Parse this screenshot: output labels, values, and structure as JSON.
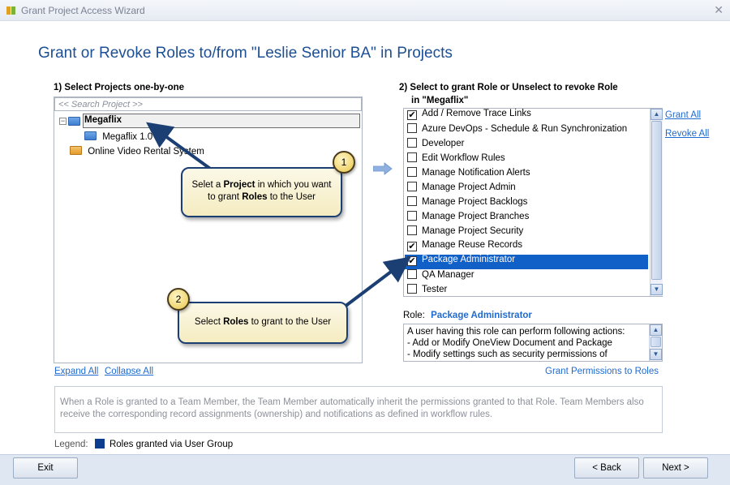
{
  "window": {
    "title": "Grant Project Access Wizard"
  },
  "heading": "Grant or Revoke Roles to/from \"Leslie Senior BA\" in Projects",
  "projects_section": {
    "label": "1) Select Projects one-by-one",
    "search_placeholder": "<< Search Project >>",
    "tree": [
      {
        "label": "Megaflix",
        "expanded": true,
        "selected": true,
        "icon": "folder-icon"
      },
      {
        "label": "Megaflix 1.0",
        "icon": "folder-icon"
      },
      {
        "label": "Online Video Rental System",
        "icon": "folder-icon"
      }
    ],
    "expand_all": "Expand All",
    "collapse_all": "Collapse All"
  },
  "roles_section": {
    "label_line1": "2) Select to grant Role or Unselect to revoke Role",
    "label_line2": "in \"Megaflix\"",
    "grant_all": "Grant All",
    "revoke_all": "Revoke All",
    "roles": [
      {
        "label": "Add / Remove Trace Links",
        "checked": true
      },
      {
        "label": "Azure DevOps - Schedule & Run Synchronization",
        "checked": false
      },
      {
        "label": "Developer",
        "checked": false
      },
      {
        "label": "Edit Workflow Rules",
        "checked": false
      },
      {
        "label": "Manage Notification Alerts",
        "checked": false
      },
      {
        "label": "Manage Project Admin",
        "checked": false
      },
      {
        "label": "Manage Project Backlogs",
        "checked": false
      },
      {
        "label": "Manage Project Branches",
        "checked": false
      },
      {
        "label": "Manage Project Security",
        "checked": false
      },
      {
        "label": "Manage Reuse Records",
        "checked": true
      },
      {
        "label": "Package Administrator",
        "checked": true,
        "selected": true
      },
      {
        "label": "QA Manager",
        "checked": false
      },
      {
        "label": "Tester",
        "checked": false
      }
    ],
    "role_label": "Role:",
    "role_name": "Package Administrator",
    "role_description": [
      "A user having this role can perform following actions:",
      "- Add or Modify OneView Document and Package",
      "- Modify settings such as security permissions of"
    ],
    "grant_permissions_link": "Grant Permissions to Roles"
  },
  "info_text": "When a Role is granted to a Team Member, the Team Member automatically inherit the permissions granted to that Role. Team Members also receive the corresponding record assignments (ownership) and notifications as defined in workflow rules.",
  "legend": {
    "label": "Legend:",
    "item": "Roles granted via User Group",
    "color": "#0c3d8f"
  },
  "buttons": {
    "exit": "Exit",
    "back": "< Back",
    "next": "Next >"
  },
  "callouts": [
    {
      "number": "1",
      "text_before": "Selet a ",
      "bold1": "Project",
      "text_mid": " in which you want to grant ",
      "bold2": "Roles",
      "text_after": " to the User"
    },
    {
      "number": "2",
      "text_before": "Select ",
      "bold1": "Roles",
      "text_after": " to grant to the User"
    }
  ],
  "colors": {
    "accent": "#1f6ad0",
    "heading": "#1c4f94",
    "selection": "#1060c8",
    "callout_border": "#1c3f73"
  }
}
